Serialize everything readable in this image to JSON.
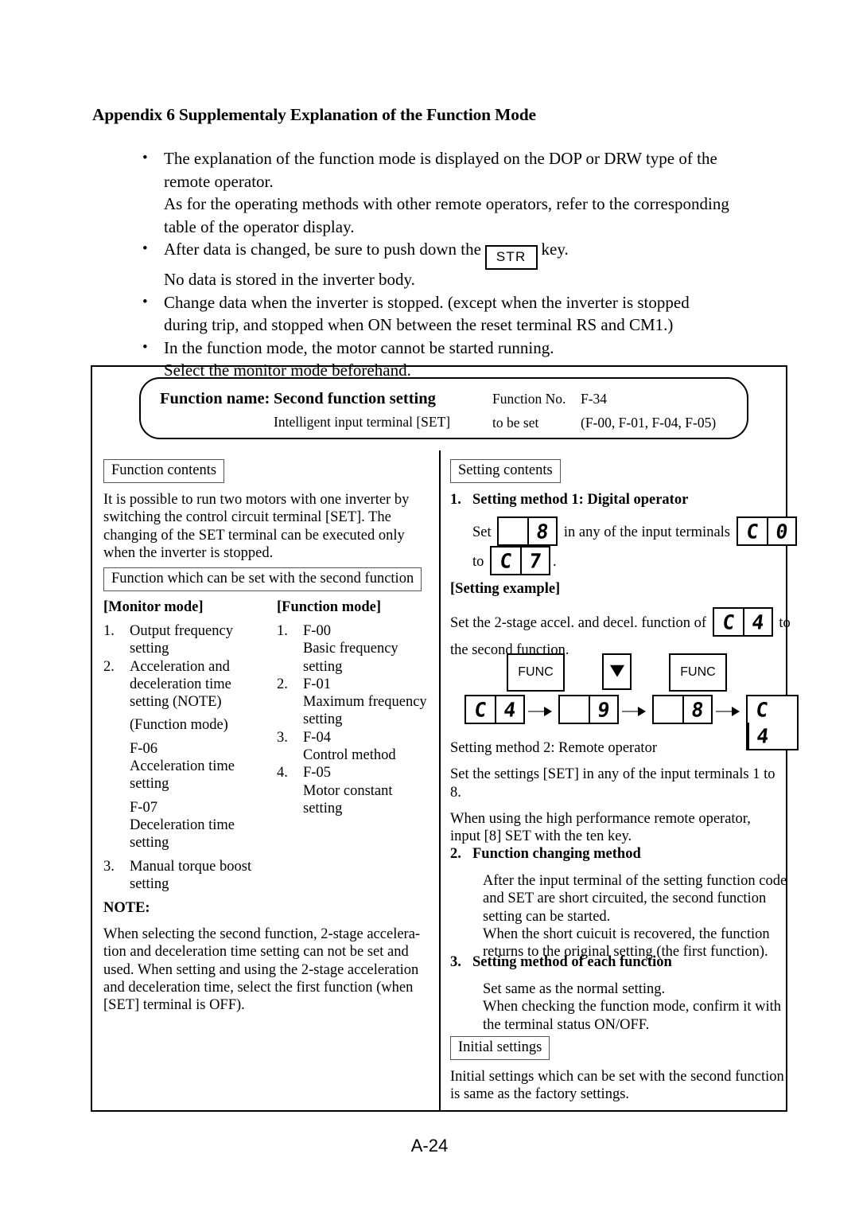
{
  "page": {
    "title": "Appendix 6  Supplementaly Explanation of the Function Mode",
    "number": "A-24"
  },
  "intro": {
    "bullets": [
      {
        "lines": [
          "The explanation of the function mode is displayed on the DOP or DRW type of the",
          "remote operator.",
          "As for the operating methods with other remote operators, refer to the corresponding",
          "table of the operator display."
        ]
      },
      {
        "lines": [
          "After data is changed, be sure to push down the",
          "No data is stored in the inverter body."
        ],
        "key_label": "STR",
        "after_key": "key."
      },
      {
        "lines": [
          "Change data when the inverter is stopped.  (except when the inverter is stopped",
          "during trip, and stopped when ON between the reset terminal RS and CM1.)"
        ]
      },
      {
        "lines": [
          "In the function mode, the motor cannot be started running.",
          "Select the monitor mode beforehand."
        ]
      }
    ],
    "bullet_char": "•"
  },
  "function_header": {
    "name_label": "Function name:",
    "name_value": "Second function setting",
    "subtitle": "Intelligent input terminal [SET]",
    "number_label": "Function No.",
    "number_value": "F-34",
    "to_be_set_label": "to be set",
    "to_be_set_value": "(F-00, F-01, F-04, F-05)"
  },
  "left_column": {
    "contents_caption": "Function contents",
    "contents_text": [
      "It is possible to run two motors with one inverter by",
      "switching the control circuit terminal [SET].  The",
      "changing of the SET terminal can be executed only",
      "when the inverter is stopped."
    ],
    "second_function_caption": "Function which can be set with the second function",
    "monitor_mode": {
      "heading": "[Monitor mode]",
      "items": [
        {
          "num": "1.",
          "lines": [
            "Output frequency",
            "setting"
          ]
        },
        {
          "num": "2.",
          "lines": [
            "Acceleration and",
            "deceleration time",
            "setting (NOTE)"
          ]
        },
        {
          "num": "",
          "lines": [
            "(Function mode)"
          ]
        },
        {
          "num": "",
          "lines": [
            "F-06",
            "Acceleration time",
            "setting"
          ]
        },
        {
          "num": "",
          "lines": [
            "F-07",
            "Deceleration time",
            "setting"
          ]
        },
        {
          "num": "3.",
          "lines": [
            "Manual torque boost",
            "setting"
          ]
        }
      ]
    },
    "function_mode": {
      "heading": "[Function mode]",
      "items": [
        {
          "num": "1.",
          "lines": [
            "F-00",
            "Basic frequency",
            "setting"
          ]
        },
        {
          "num": "2.",
          "lines": [
            "F-01",
            "Maximum frequency",
            "setting"
          ]
        },
        {
          "num": "3.",
          "lines": [
            "F-04",
            "Control method"
          ]
        },
        {
          "num": "4.",
          "lines": [
            "F-05",
            "Motor constant",
            "setting"
          ]
        }
      ]
    },
    "note": {
      "heading": "NOTE:",
      "lines": [
        "When selecting the second function, 2-stage accelera-",
        "tion and deceleration time setting can not be set and",
        "used.  When setting and using the 2-stage acceleration",
        "and deceleration time, select the first function (when",
        "[SET] terminal is OFF)."
      ]
    }
  },
  "right_column": {
    "settings_caption": "Setting contents",
    "method1": {
      "num": "1.",
      "heading": "Setting method 1: Digital operator",
      "set_word": "Set",
      "display_1": [
        "",
        "8"
      ],
      "mid_text": "in any of the input terminals",
      "display_2": [
        "C",
        "0"
      ],
      "to_word": "to",
      "display_3": [
        "C",
        "7"
      ],
      "period": "."
    },
    "setting_example": {
      "heading": "[Setting example]",
      "lines": [
        "Set the 2-stage accel. and decel. function of",
        "to",
        "the second function."
      ],
      "inline_display": [
        "C",
        "4"
      ],
      "keys": [
        {
          "label": "FUNC",
          "type": "text"
        },
        {
          "label": "down-arrow",
          "type": "arrow"
        },
        {
          "label": "FUNC",
          "type": "text"
        }
      ],
      "sequence": [
        [
          "C",
          "4"
        ],
        [
          "",
          "9"
        ],
        [
          "",
          "8"
        ],
        [
          "C",
          "4"
        ]
      ]
    },
    "method2": {
      "heading": "Setting method 2:  Remote operator",
      "paragraphs": [
        [
          "Set the settings [SET] in any of the input terminals 1 to",
          "8."
        ],
        [
          "When using the high performance remote operator,",
          "input [8] SET with the ten key."
        ]
      ]
    },
    "method_change": {
      "num": "2.",
      "heading": "Function changing method",
      "lines": [
        "After the input terminal of the setting function code",
        "and SET are short circuited, the second function",
        "setting can be started.",
        "When the short cuicuit is recovered, the function",
        "returns to the original setting (the first function)."
      ]
    },
    "method_each": {
      "num": "3.",
      "heading": "Setting method of each function",
      "lines": [
        "Set same as the normal setting.",
        "When checking the function mode, confirm it with",
        "the terminal status ON/OFF."
      ]
    },
    "initial_settings": {
      "caption": "Initial settings",
      "lines": [
        "Initial settings which can be set with the second function",
        "is same as the factory settings."
      ]
    }
  }
}
